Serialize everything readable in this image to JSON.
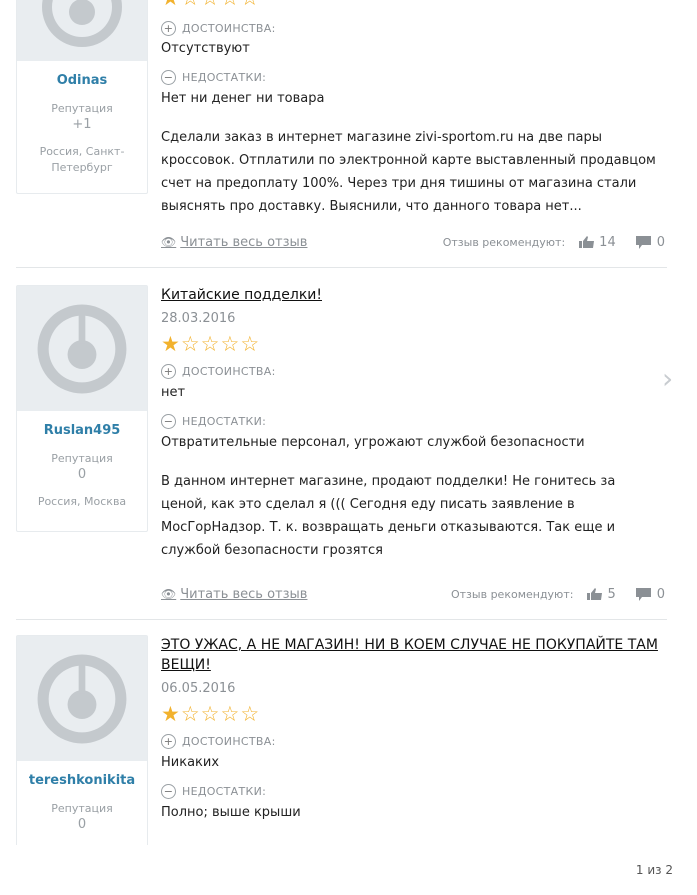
{
  "labels": {
    "reputation": "Репутация",
    "pros": "ДОСТОИНСТВА:",
    "cons": "НЕДОСТАТКИ:",
    "read_full": "Читать весь отзыв",
    "recommend": "Отзыв рекомендуют:"
  },
  "reviews": [
    {
      "user": "Odinas",
      "reputation": "+1",
      "location": "Россия, Санкт-Петербург",
      "rating": 1,
      "pros": "Отсутствуют",
      "cons": "Нет ни денег ни товара",
      "body": "Сделали заказ в интернет магазине zivi-sportom.ru на две пары кроссовок. Отплатили по электронной карте выставленный продавцом счет на предоплату 100%. Через три дня тишины от магазина стали выяснять про доставку. Выяснили, что данного товара нет...",
      "likes": "14",
      "comments": "0"
    },
    {
      "user": "Ruslan495",
      "reputation": "0",
      "location": "Россия, Москва",
      "title": "Китайские подделки!",
      "date": "28.03.2016",
      "rating": 1,
      "pros": "нет",
      "cons": "Отвратительные персонал, угрожают службой безопасности",
      "body": "В данном интернет магазине, продают подделки! Не гонитесь за ценой, как это сделал я ((( Сегодня еду писать заявление в МосГорНадзор. Т. к. возвращать деньги отказываются. Так еще и службой безопасности грозятся",
      "likes": "5",
      "comments": "0"
    },
    {
      "user": "tereshkonikita",
      "reputation": "0",
      "title": "ЭТО УЖАС, А НЕ МАГАЗИН! НИ В КОЕМ СЛУЧАЕ НЕ ПОКУПАЙТЕ ТАМ ВЕЩИ!",
      "date": "06.05.2016",
      "rating": 1,
      "pros": "Никаких",
      "cons": "Полно; выше крыши"
    }
  ],
  "pager": "1 из 2",
  "icons": {
    "next": "chevron-right-icon",
    "pros": "plus-circle-icon",
    "cons": "minus-circle-icon",
    "read": "eye-icon",
    "like": "thumbs-up-icon",
    "comment": "comment-icon"
  },
  "colors": {
    "username": "#2f7fa8",
    "star": "#f2b22e",
    "muted": "#8b9095"
  }
}
